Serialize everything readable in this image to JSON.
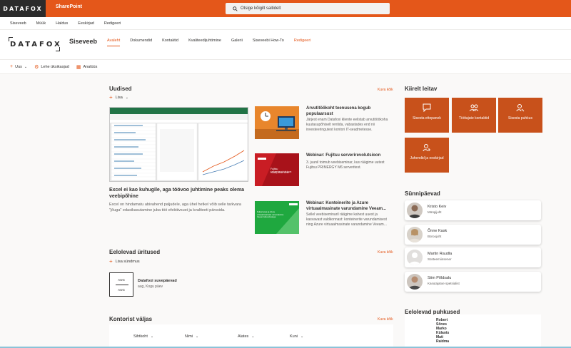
{
  "suite": {
    "logo": "DATAFOX",
    "app_name": "SharePoint",
    "search_placeholder": "Otsige kõigilt saitidelt"
  },
  "hub_nav": [
    "Siseveeb",
    "Müük",
    "Haldus",
    "Eeskirjad",
    "Redigeeri"
  ],
  "site": {
    "logo": "DATAFOX",
    "title": "Siseveeb",
    "tabs": [
      "Avaleht",
      "Dokumendid",
      "Kontaktid",
      "Kvaliteedijuhtimine",
      "Galerii",
      "Siseveebi How-To",
      "Redigeeri"
    ]
  },
  "command_bar": {
    "new": "Uus",
    "page_details": "Lehe üksikasjad",
    "analytics": "Analüüs"
  },
  "news": {
    "title": "Uudised",
    "see_all": "Kuva kõik",
    "add": "Lisa",
    "hero": {
      "title": "Excel ei kao kuhugile, aga töövoo juhtimine peaks olema veebipõhine",
      "desc": "Excel on hindamatu abivahend paljudele, aga ühel hetkel võib selle tarkvara \"jõuga\" edasikasutamine juba töö efektiivsust ja kvaliteeti pärssida."
    },
    "items": [
      {
        "title": "Arvutitöökoht teenusena kogub populaarsust",
        "desc": "Järjest enam Datafoxi kliente eelistab arvutitöökoha kuutasupõhiselt rentida, vabastades end nii investeeringutest kontori IT-seadmetesse."
      },
      {
        "title": "Webinar: Fujitsu serverirevolutsioon",
        "desc": "3. juunil toimub veebiseminar, kus räägime uutest Fujitsu PRIMERGY M6 serveritest.",
        "thumb_text": "Fujitsu serverirevolutsioon",
        "thumb_sub": "Tuesday, 09:30 - 10:30"
      },
      {
        "title": "Webinar: Konteinerite ja Azure virtuaalmasinate varundamine Veeam...",
        "desc": "Sellel veebiseminaril räägime kahest uuest ja kasvavast valdkonnast: konteinerite varundamisest ning Azure virtuaalmasinate varundamine Veeam...",
        "thumb_text": "Kubernetes ja Azure virtuaalmasinate varundamine Veeam lahendustega"
      }
    ]
  },
  "events": {
    "title": "Eelolevad üritused",
    "see_all": "Kuva kõik",
    "add": "Lisa sündmus",
    "card": {
      "month_top": "AUG",
      "month_bottom": "AUG",
      "title": "Datafoxi suvepäevad",
      "sub": "aug, Kogu päev"
    }
  },
  "office": {
    "title": "Kontorist väljas",
    "see_all": "Kuva kõik",
    "columns": [
      "Sihtkoht",
      "Nimi",
      "Alates",
      "Kuni"
    ]
  },
  "quick_links": {
    "title": "Kiirelt leitav",
    "items": [
      "Sisesta ettepanek",
      "Töötajate kontaktid",
      "Sisesta puhkus",
      "Juhendid ja eeskirjad"
    ]
  },
  "birthdays": {
    "title": "Sünnipäevad",
    "people": [
      {
        "name": "Kristo Keiv",
        "role": "Müügijuht"
      },
      {
        "name": "Õnne Kask",
        "role": "Büroojuht"
      },
      {
        "name": "Martin Raudla",
        "role": "Süsteemiinsener"
      },
      {
        "name": "Siim Põldsalu",
        "role": "Kasutajatoe spetsialist"
      }
    ]
  },
  "vacations": {
    "title": "Eelolevad puhkused",
    "names": [
      "Robert",
      "Sõnes",
      "Marko",
      "Külaots",
      "Mati",
      "Raidma"
    ]
  },
  "colors": {
    "accent": "#e4571a",
    "tile": "#c8511b"
  }
}
